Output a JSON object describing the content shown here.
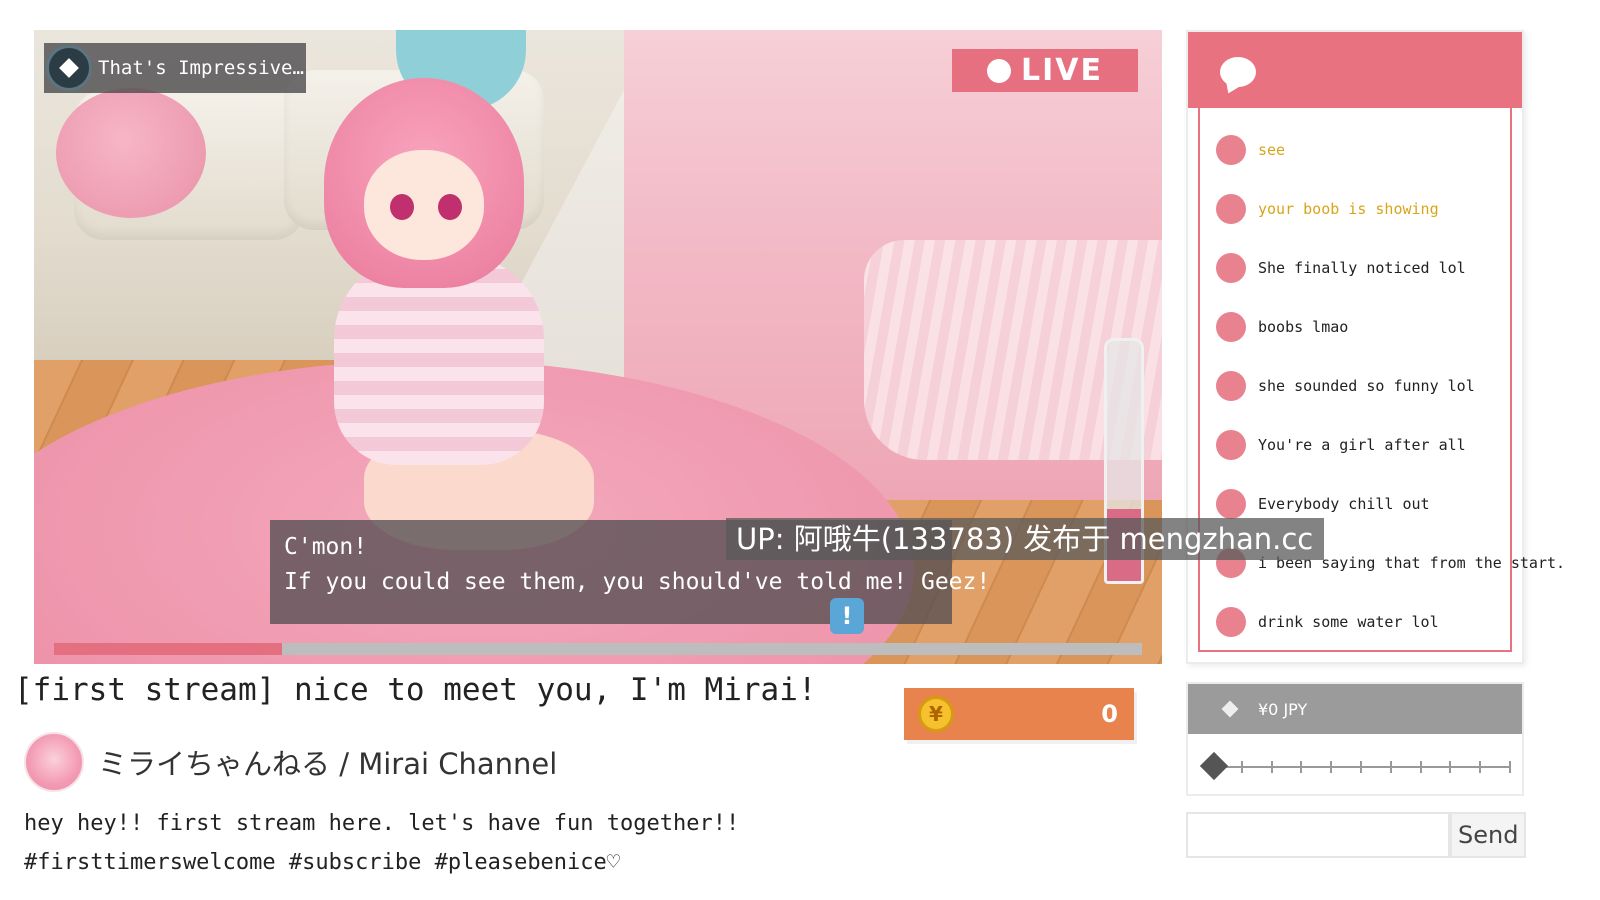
{
  "stream": {
    "achievement": "That's Impressive…",
    "live_label": "LIVE",
    "meter_level": 0.3,
    "progress": 0.21,
    "dialog": {
      "lines": [
        "C'mon!",
        "If you could see them, you should've told me! Geez!"
      ]
    },
    "alert_icon": "!",
    "watermark": "UP: 阿哦牛(133783) 发布于 mengzhan.cc"
  },
  "video": {
    "title": "[first stream] nice to meet you, I'm Mirai!",
    "channel": "ミライちゃんねる / Mirai Channel",
    "description": [
      "hey hey!! first stream here. let's have fun together!!",
      "#firsttimerswelcome #subscribe #pleasebenice♡"
    ]
  },
  "currency": {
    "icon": "¥",
    "count": "0"
  },
  "chat": {
    "icon": "chat-bubble-icon",
    "messages": [
      {
        "text": "see",
        "highlight": true
      },
      {
        "text": "your boob is showing",
        "highlight": true
      },
      {
        "text": "She finally noticed lol",
        "highlight": false
      },
      {
        "text": "boobs lmao",
        "highlight": false
      },
      {
        "text": "she sounded so funny lol",
        "highlight": false
      },
      {
        "text": "You're a girl after all",
        "highlight": false
      },
      {
        "text": "Everybody chill out",
        "highlight": false
      },
      {
        "text": "i been saying that from the start.",
        "highlight": false
      },
      {
        "text": "drink some water lol",
        "highlight": false
      }
    ]
  },
  "tip": {
    "amount_label": "¥0 JPY",
    "slider_value": 0
  },
  "send": {
    "button_label": "Send",
    "input_value": ""
  },
  "colors": {
    "accent_pink": "#e8727f",
    "highlight_yellow": "#d8a51a",
    "coin_orange": "#e8834e"
  }
}
